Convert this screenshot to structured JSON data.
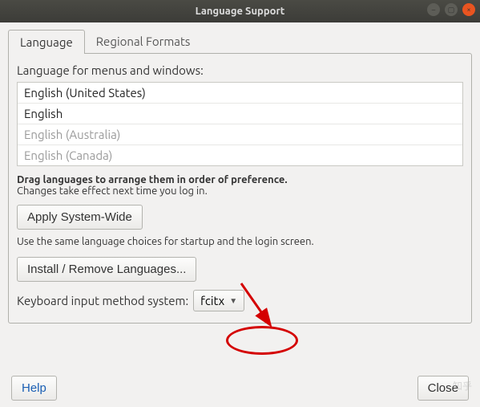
{
  "window": {
    "title": "Language Support"
  },
  "tabs": {
    "language": "Language",
    "regional": "Regional Formats"
  },
  "section": {
    "label": "Language for menus and windows:"
  },
  "languages": {
    "l0": "English (United States)",
    "l1": "English",
    "l2": "English (Australia)",
    "l3": "English (Canada)"
  },
  "hints": {
    "drag_bold": "Drag languages to arrange them in order of preference.",
    "drag_sub": "Changes take effect next time you log in.",
    "apply_sub": "Use the same language choices for startup and the login screen."
  },
  "buttons": {
    "apply": "Apply System-Wide",
    "install": "Install / Remove Languages...",
    "help": "Help",
    "close": "Close"
  },
  "im": {
    "label": "Keyboard input method system:",
    "selected": "fcitx"
  },
  "watermark": "知乎"
}
